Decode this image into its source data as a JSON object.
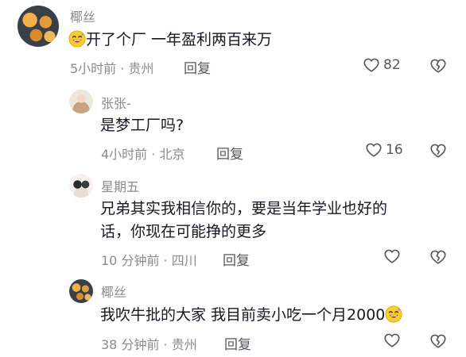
{
  "comments": [
    {
      "username": "椰丝",
      "text": "开了个厂  一年盈利两百来万",
      "emoji_prefix": "grinning-sweat-emoji",
      "time": "5小时前",
      "location": "贵州",
      "reply_label": "回复",
      "likes": "82"
    },
    {
      "username": "张张-",
      "text": "是梦工厂吗?",
      "time": "4小时前",
      "location": "北京",
      "reply_label": "回复",
      "likes": "16"
    },
    {
      "username": "星期五",
      "text_line1": "兄弟其实我相信你的，要是当年学业也好的",
      "text_line2": "话，你现在可能挣的更多",
      "time": "10 分钟前",
      "location": "四川",
      "reply_label": "回复",
      "likes": ""
    },
    {
      "username": "椰丝",
      "text": "我吹牛批的大家  我目前卖小吃一个月2000",
      "emoji_suffix": "grinning-sweat-emoji",
      "time": "38 分钟前",
      "location": "贵州",
      "reply_label": "回复",
      "likes": ""
    }
  ],
  "icons": {
    "like": "heart-outline-icon",
    "dislike": "broken-heart-outline-icon"
  },
  "colors": {
    "text": "#161823",
    "secondary": "#8a8b91",
    "action": "#55575e"
  }
}
